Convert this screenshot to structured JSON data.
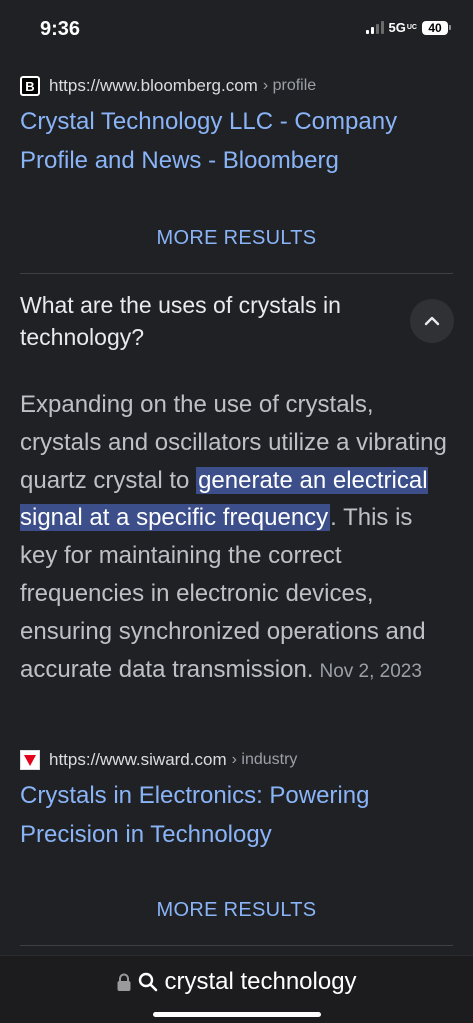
{
  "status_bar": {
    "time": "9:36",
    "network": "5G",
    "network_suffix": "UC",
    "battery": "40"
  },
  "results": [
    {
      "url": "https://www.bloomberg.com",
      "path": "› profile",
      "title_line1": "Crystal Technology LLC - Company",
      "title_line2": "Profile and News - Bloomberg",
      "favicon_letter": "B"
    },
    {
      "url": "https://www.siward.com",
      "path": "› industry",
      "title_line1": "Crystals in Electronics: Powering",
      "title_line2": "Precision in Technology"
    }
  ],
  "more_results_label": "MORE RESULTS",
  "people_also_ask": {
    "question": "What are the uses of crystals in technology?",
    "answer_before": "Expanding on the use of crystals, crystals and oscillators utilize a vibrating quartz crystal to ",
    "answer_highlight": "generate an electrical signal at a specific frequency",
    "answer_after": ". This is key for maintaining the correct frequencies in electronic devices, ensuring synchronized operations and accurate data transmission.",
    "date": "Nov 2, 2023"
  },
  "address_bar": {
    "query": "crystal technology"
  },
  "icons": {
    "lock": "lock-icon",
    "search": "search-icon",
    "chevron": "chevron-up-icon"
  }
}
